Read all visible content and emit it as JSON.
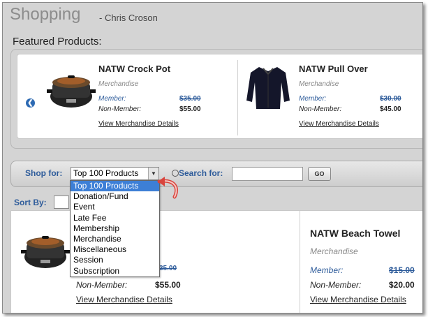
{
  "header": {
    "title": "Shopping",
    "subtitle": "- Chris Croson"
  },
  "featured": {
    "label": "Featured Products:",
    "products": [
      {
        "name": "NATW Crock Pot",
        "category": "Merchandise",
        "member_label": "Member:",
        "member_price": "$35.00",
        "nonmember_label": "Non-Member:",
        "nonmember_price": "$55.00",
        "link": "View Merchandise Details",
        "image_icon": "crock-pot-image"
      },
      {
        "name": "NATW Pull Over",
        "category": "Merchandise",
        "member_label": "Member:",
        "member_price": "$30.00",
        "nonmember_label": "Non-Member:",
        "nonmember_price": "$45.00",
        "link": "View Merchandise Details",
        "image_icon": "pull-over-jacket-image"
      }
    ]
  },
  "shop_bar": {
    "shop_for_label": "Shop for:",
    "selected": "Top 100 Products",
    "search_label": "Search for:",
    "search_value": "",
    "go_label": "GO"
  },
  "dropdown": {
    "options": [
      "Top 100 Products",
      "Donation/Fund",
      "Event",
      "Late Fee",
      "Membership",
      "Merchandise",
      "Miscellaneous",
      "Session",
      "Subscription"
    ],
    "highlighted_index": 0
  },
  "sort": {
    "label": "Sort By:"
  },
  "results": {
    "products": [
      {
        "name": "",
        "category": "",
        "member_label": "",
        "member_price": "35.00",
        "nonmember_label": "Non-Member:",
        "nonmember_price": "$55.00",
        "link": "View Merchandise Details",
        "image_icon": "crock-pot-image"
      },
      {
        "name": "NATW Beach Towel",
        "category": "Merchandise",
        "member_label": "Member:",
        "member_price": "$15.00",
        "nonmember_label": "Non-Member:",
        "nonmember_price": "$20.00",
        "link": "View Merchandise Details"
      }
    ]
  },
  "colors": {
    "accent_blue": "#2d5b9a",
    "highlight": "#3d7fd6",
    "callout_red": "#d9443d"
  }
}
